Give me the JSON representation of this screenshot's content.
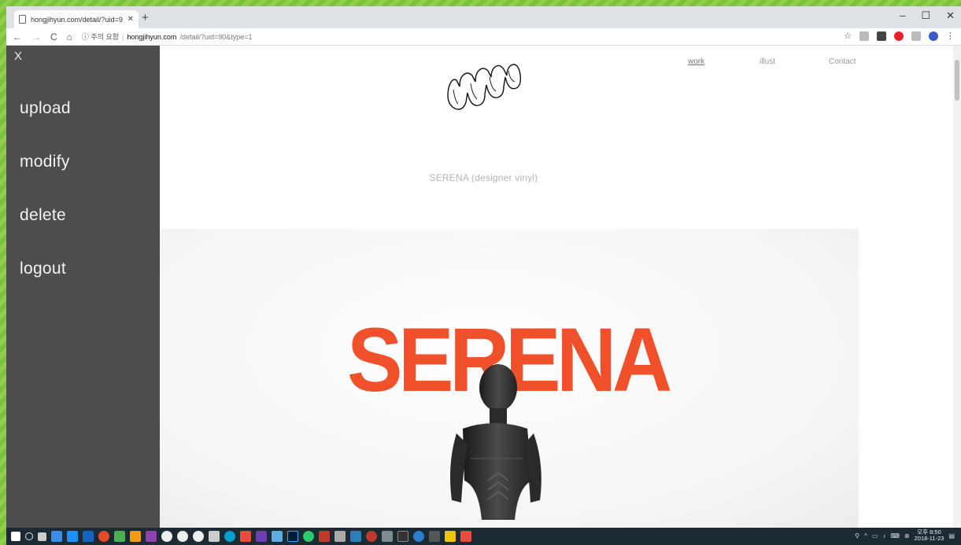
{
  "browser": {
    "tab_title": "hongjihyun.com/detail/?uid=90...",
    "new_tab": "+",
    "url_warning": "ⓘ 주의 요함",
    "url_host": "hongjihyun.com",
    "url_path": "/detail/?uid=90&type=1",
    "window_controls": [
      "–",
      "☐",
      "✕"
    ]
  },
  "site": {
    "nav": [
      {
        "label": "work",
        "active": true
      },
      {
        "label": "illust",
        "active": false
      },
      {
        "label": "Contact",
        "active": false
      }
    ],
    "work_title": "SERENA (designer vinyl)",
    "hero_text": "SERENA"
  },
  "sidebar": {
    "close_label": "X",
    "items": [
      {
        "label": "upload"
      },
      {
        "label": "modify"
      },
      {
        "label": "delete"
      },
      {
        "label": "logout"
      }
    ]
  },
  "taskbar": {
    "time": "오후 8:50",
    "date": "2018-11-23"
  },
  "colors": {
    "sidebar_bg": "#4d4d4d",
    "hero_accent": "#f0502a",
    "desktop": "#7cc13a"
  }
}
